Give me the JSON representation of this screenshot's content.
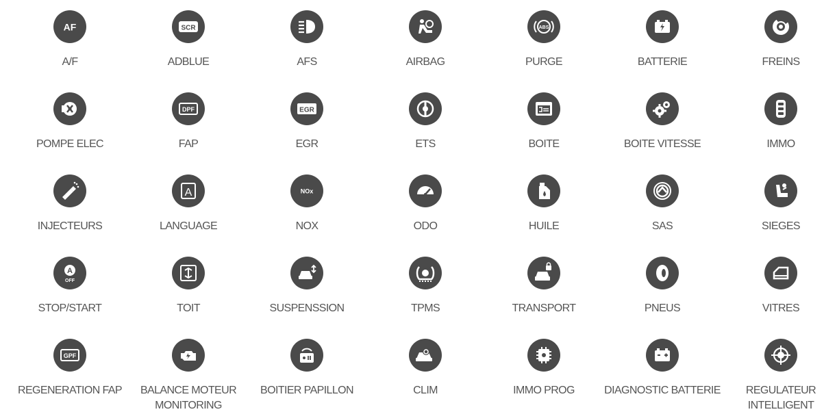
{
  "colors": {
    "icon_circle": "#4a4a4a",
    "icon_glyph": "#ffffff",
    "label_text": "#555555",
    "background": "#ffffff"
  },
  "tiles": [
    {
      "label": "A/F",
      "icon": "af-badge-icon"
    },
    {
      "label": "ADBLUE",
      "icon": "scr-badge-icon"
    },
    {
      "label": "AFS",
      "icon": "headlight-icon"
    },
    {
      "label": "AIRBAG",
      "icon": "airbag-icon"
    },
    {
      "label": "PURGE",
      "icon": "abs-icon"
    },
    {
      "label": "BATTERIE",
      "icon": "battery-charge-icon"
    },
    {
      "label": "FREINS",
      "icon": "brake-disc-icon"
    },
    {
      "label": "POMPE ELEC",
      "icon": "pump-icon"
    },
    {
      "label": "FAP",
      "icon": "dpf-badge-icon"
    },
    {
      "label": "EGR",
      "icon": "egr-badge-icon"
    },
    {
      "label": "ETS",
      "icon": "ets-icon"
    },
    {
      "label": "BOITE",
      "icon": "gearbox-screen-icon"
    },
    {
      "label": "BOITE VITESSE",
      "icon": "gears-icon"
    },
    {
      "label": "IMMO",
      "icon": "car-key-icon"
    },
    {
      "label": "INJECTEURS",
      "icon": "injector-icon"
    },
    {
      "label": "LANGUAGE",
      "icon": "language-icon"
    },
    {
      "label": "NOX",
      "icon": "nox-badge-icon"
    },
    {
      "label": "ODO",
      "icon": "speedometer-icon"
    },
    {
      "label": "HUILE",
      "icon": "oil-can-icon"
    },
    {
      "label": "SAS",
      "icon": "steering-angle-icon"
    },
    {
      "label": "SIEGES",
      "icon": "seat-icon"
    },
    {
      "label": "STOP/START",
      "icon": "stop-start-icon"
    },
    {
      "label": "TOIT",
      "icon": "sunroof-icon"
    },
    {
      "label": "SUSPENSSION",
      "icon": "car-suspension-icon"
    },
    {
      "label": "TPMS",
      "icon": "tpms-icon"
    },
    {
      "label": "TRANSPORT",
      "icon": "car-lock-icon"
    },
    {
      "label": "PNEUS",
      "icon": "tire-icon"
    },
    {
      "label": "VITRES",
      "icon": "window-icon"
    },
    {
      "label": "REGENERATION FAP",
      "icon": "gpf-badge-icon"
    },
    {
      "label": "BALANCE MOTEUR MONITORING",
      "icon": "engine-icon"
    },
    {
      "label": "BOITIER PAPILLON",
      "icon": "throttle-icon"
    },
    {
      "label": "CLIM",
      "icon": "ac-car-icon"
    },
    {
      "label": "IMMO PROG",
      "icon": "chip-icon"
    },
    {
      "label": "DIAGNOSTIC BATTERIE",
      "icon": "battery-icon"
    },
    {
      "label": "REGULATEUR INTELLIGENT",
      "icon": "cruise-target-icon"
    }
  ]
}
